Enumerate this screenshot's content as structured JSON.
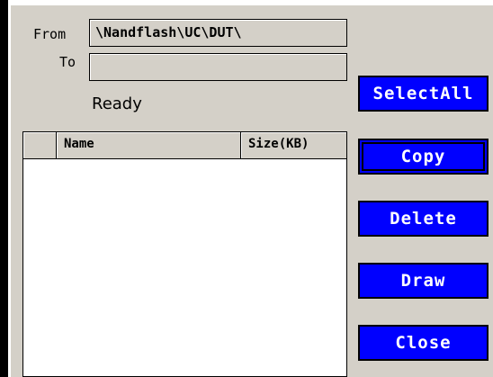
{
  "form": {
    "from_label": "From",
    "from_value": "\\Nandflash\\UC\\DUT\\",
    "to_label": "To",
    "to_value": ""
  },
  "status": "Ready",
  "file_list": {
    "columns": [
      "",
      "Name",
      "Size(KB)"
    ],
    "rows": []
  },
  "buttons": {
    "select_all": "SelectAll",
    "copy": "Copy",
    "delete": "Delete",
    "draw": "Draw",
    "close": "Close"
  },
  "colors": {
    "button_bg": "#0000ff",
    "button_text": "#ffffff",
    "panel_bg": "#d4d0c8"
  }
}
